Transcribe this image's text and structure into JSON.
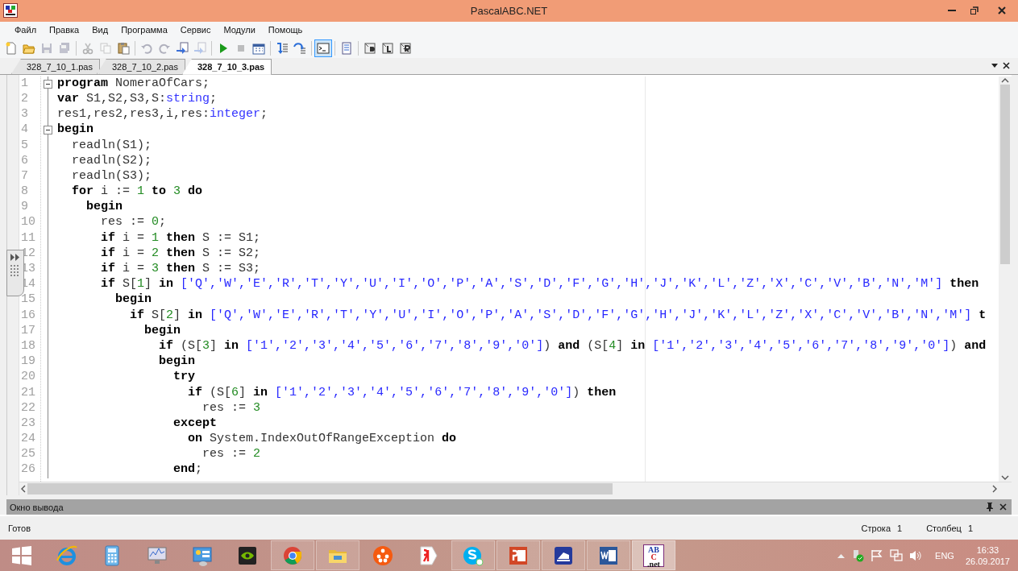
{
  "window": {
    "title": "PascalABC.NET"
  },
  "menu": [
    {
      "label": "Файл"
    },
    {
      "label": "Правка"
    },
    {
      "label": "Вид"
    },
    {
      "label": "Программа"
    },
    {
      "label": "Сервис"
    },
    {
      "label": "Модули"
    },
    {
      "label": "Помощь"
    }
  ],
  "toolbar": [
    {
      "kind": "new",
      "disabled": false,
      "pressed": false
    },
    {
      "kind": "open",
      "disabled": false,
      "pressed": false
    },
    {
      "kind": "save",
      "disabled": true,
      "pressed": false
    },
    {
      "kind": "saveall",
      "disabled": true,
      "pressed": false
    },
    {
      "kind": "separator"
    },
    {
      "kind": "cut",
      "disabled": true,
      "pressed": false
    },
    {
      "kind": "copy",
      "disabled": true,
      "pressed": false
    },
    {
      "kind": "paste",
      "disabled": false,
      "pressed": false
    },
    {
      "kind": "separator"
    },
    {
      "kind": "undo",
      "disabled": true,
      "pressed": false
    },
    {
      "kind": "redo",
      "disabled": true,
      "pressed": false
    },
    {
      "kind": "docarrow",
      "disabled": false,
      "pressed": false
    },
    {
      "kind": "docarrow",
      "disabled": true,
      "pressed": false
    },
    {
      "kind": "separator"
    },
    {
      "kind": "run",
      "disabled": false,
      "pressed": false
    },
    {
      "kind": "stop",
      "disabled": true,
      "pressed": false
    },
    {
      "kind": "calendar",
      "disabled": false,
      "pressed": false
    },
    {
      "kind": "separator"
    },
    {
      "kind": "stepinto",
      "disabled": false,
      "pressed": false
    },
    {
      "kind": "stepover",
      "disabled": false,
      "pressed": false
    },
    {
      "kind": "separator"
    },
    {
      "kind": "console",
      "disabled": false,
      "pressed": true
    },
    {
      "kind": "separator"
    },
    {
      "kind": "doc",
      "disabled": false,
      "pressed": false
    },
    {
      "kind": "separator"
    },
    {
      "kind": "tplD",
      "disabled": false,
      "pressed": false
    },
    {
      "kind": "tplL",
      "disabled": false,
      "pressed": false
    },
    {
      "kind": "tplR",
      "disabled": false,
      "pressed": false
    }
  ],
  "tabs": [
    {
      "label": "328_7_10_1.pas",
      "selected": false
    },
    {
      "label": "328_7_10_2.pas",
      "selected": false
    },
    {
      "label": "328_7_10_3.pas",
      "selected": true
    }
  ],
  "editor": {
    "lines": [
      {
        "number": "1",
        "fold": true,
        "tokens": [
          {
            "kind": "kw",
            "text": "program"
          },
          {
            "kind": "plain",
            "text": " NomeraOfCars;"
          }
        ]
      },
      {
        "number": "2",
        "fold": false,
        "tokens": [
          {
            "kind": "kw",
            "text": "var"
          },
          {
            "kind": "plain",
            "text": " S1,S2,S3,S:"
          },
          {
            "kind": "type",
            "text": "string"
          },
          {
            "kind": "plain",
            "text": ";"
          }
        ]
      },
      {
        "number": "3",
        "fold": false,
        "tokens": [
          {
            "kind": "plain",
            "text": "res1,res2,res3,i,res:"
          },
          {
            "kind": "type",
            "text": "integer"
          },
          {
            "kind": "plain",
            "text": ";"
          }
        ]
      },
      {
        "number": "4",
        "fold": true,
        "tokens": [
          {
            "kind": "kw",
            "text": "begin"
          }
        ]
      },
      {
        "number": "5",
        "fold": false,
        "tokens": [
          {
            "kind": "plain",
            "text": "  readln(S1);"
          }
        ]
      },
      {
        "number": "6",
        "fold": false,
        "tokens": [
          {
            "kind": "plain",
            "text": "  readln(S2);"
          }
        ]
      },
      {
        "number": "7",
        "fold": false,
        "tokens": [
          {
            "kind": "plain",
            "text": "  readln(S3);"
          }
        ]
      },
      {
        "number": "8",
        "fold": false,
        "tokens": [
          {
            "kind": "kw",
            "text": "  for"
          },
          {
            "kind": "plain",
            "text": " i := "
          },
          {
            "kind": "num",
            "text": "1"
          },
          {
            "kind": "kw",
            "text": " to"
          },
          {
            "kind": "num",
            "text": " 3"
          },
          {
            "kind": "kw",
            "text": " do"
          }
        ]
      },
      {
        "number": "9",
        "fold": false,
        "tokens": [
          {
            "kind": "kw",
            "text": "    begin"
          }
        ]
      },
      {
        "number": "10",
        "fold": false,
        "tokens": [
          {
            "kind": "plain",
            "text": "      res := "
          },
          {
            "kind": "num",
            "text": "0"
          },
          {
            "kind": "plain",
            "text": ";"
          }
        ]
      },
      {
        "number": "11",
        "fold": false,
        "tokens": [
          {
            "kind": "kw",
            "text": "      if"
          },
          {
            "kind": "plain",
            "text": " i = "
          },
          {
            "kind": "num",
            "text": "1"
          },
          {
            "kind": "kw",
            "text": " then"
          },
          {
            "kind": "plain",
            "text": " S := S1;"
          }
        ]
      },
      {
        "number": "12",
        "fold": false,
        "tokens": [
          {
            "kind": "kw",
            "text": "      if"
          },
          {
            "kind": "plain",
            "text": " i = "
          },
          {
            "kind": "num",
            "text": "2"
          },
          {
            "kind": "kw",
            "text": " then"
          },
          {
            "kind": "plain",
            "text": " S := S2;"
          }
        ]
      },
      {
        "number": "13",
        "fold": false,
        "tokens": [
          {
            "kind": "kw",
            "text": "      if"
          },
          {
            "kind": "plain",
            "text": " i = "
          },
          {
            "kind": "num",
            "text": "3"
          },
          {
            "kind": "kw",
            "text": " then"
          },
          {
            "kind": "plain",
            "text": " S := S3;"
          }
        ]
      },
      {
        "number": "14",
        "fold": false,
        "tokens": [
          {
            "kind": "kw",
            "text": "      if"
          },
          {
            "kind": "plain",
            "text": " S["
          },
          {
            "kind": "num",
            "text": "1"
          },
          {
            "kind": "plain",
            "text": "] "
          },
          {
            "kind": "kw",
            "text": "in"
          },
          {
            "kind": "str",
            "text": " ['Q','W','E','R','T','Y','U','I','O','P','A','S','D','F','G','H','J','K','L','Z','X','C','V','B','N','M']"
          },
          {
            "kind": "kw",
            "text": " then"
          }
        ]
      },
      {
        "number": "15",
        "fold": false,
        "tokens": [
          {
            "kind": "kw",
            "text": "        begin"
          }
        ]
      },
      {
        "number": "16",
        "fold": false,
        "tokens": [
          {
            "kind": "kw",
            "text": "          if"
          },
          {
            "kind": "plain",
            "text": " S["
          },
          {
            "kind": "num",
            "text": "2"
          },
          {
            "kind": "plain",
            "text": "] "
          },
          {
            "kind": "kw",
            "text": "in"
          },
          {
            "kind": "str",
            "text": " ['Q','W','E','R','T','Y','U','I','O','P','A','S','D','F','G','H','J','K','L','Z','X','C','V','B','N','M']"
          },
          {
            "kind": "kw",
            "text": " t"
          }
        ]
      },
      {
        "number": "17",
        "fold": false,
        "tokens": [
          {
            "kind": "kw",
            "text": "            begin"
          }
        ]
      },
      {
        "number": "18",
        "fold": false,
        "tokens": [
          {
            "kind": "kw",
            "text": "              if"
          },
          {
            "kind": "plain",
            "text": " (S["
          },
          {
            "kind": "num",
            "text": "3"
          },
          {
            "kind": "plain",
            "text": "] "
          },
          {
            "kind": "kw",
            "text": "in"
          },
          {
            "kind": "str",
            "text": " ['1','2','3','4','5','6','7','8','9','0']"
          },
          {
            "kind": "plain",
            "text": ") "
          },
          {
            "kind": "kw",
            "text": "and"
          },
          {
            "kind": "plain",
            "text": " (S["
          },
          {
            "kind": "num",
            "text": "4"
          },
          {
            "kind": "plain",
            "text": "] "
          },
          {
            "kind": "kw",
            "text": "in"
          },
          {
            "kind": "str",
            "text": " ['1','2','3','4','5','6','7','8','9','0']"
          },
          {
            "kind": "plain",
            "text": ") "
          },
          {
            "kind": "kw",
            "text": "and"
          }
        ]
      },
      {
        "number": "19",
        "fold": false,
        "tokens": [
          {
            "kind": "kw",
            "text": "              begin"
          }
        ]
      },
      {
        "number": "20",
        "fold": false,
        "tokens": [
          {
            "kind": "kw",
            "text": "                try"
          }
        ]
      },
      {
        "number": "21",
        "fold": false,
        "tokens": [
          {
            "kind": "kw",
            "text": "                  if"
          },
          {
            "kind": "plain",
            "text": " (S["
          },
          {
            "kind": "num",
            "text": "6"
          },
          {
            "kind": "plain",
            "text": "] "
          },
          {
            "kind": "kw",
            "text": "in"
          },
          {
            "kind": "str",
            "text": " ['1','2','3','4','5','6','7','8','9','0']"
          },
          {
            "kind": "plain",
            "text": ") "
          },
          {
            "kind": "kw",
            "text": "then"
          }
        ]
      },
      {
        "number": "22",
        "fold": false,
        "tokens": [
          {
            "kind": "plain",
            "text": "                    res := "
          },
          {
            "kind": "num",
            "text": "3"
          }
        ]
      },
      {
        "number": "23",
        "fold": false,
        "tokens": [
          {
            "kind": "kw",
            "text": "                except"
          }
        ]
      },
      {
        "number": "24",
        "fold": false,
        "tokens": [
          {
            "kind": "kw",
            "text": "                  on"
          },
          {
            "kind": "plain",
            "text": " System.IndexOutOfRangeException "
          },
          {
            "kind": "kw",
            "text": "do"
          }
        ]
      },
      {
        "number": "25",
        "fold": false,
        "tokens": [
          {
            "kind": "plain",
            "text": "                    res := "
          },
          {
            "kind": "num",
            "text": "2"
          }
        ]
      },
      {
        "number": "26",
        "fold": false,
        "tokens": [
          {
            "kind": "kw",
            "text": "                end"
          },
          {
            "kind": "plain",
            "text": ";"
          }
        ]
      }
    ]
  },
  "output_panel": {
    "title": "Окно вывода"
  },
  "status_bar": {
    "state": "Готов",
    "row_label": "Строка",
    "row": "1",
    "col_label": "Столбец",
    "col": "1"
  },
  "taskbar": {
    "apps": [
      {
        "kind": "ie",
        "running": false,
        "active": false
      },
      {
        "kind": "calculator",
        "running": false,
        "active": false
      },
      {
        "kind": "monitor",
        "running": false,
        "active": false
      },
      {
        "kind": "panel",
        "running": false,
        "active": false
      },
      {
        "kind": "gpu",
        "running": false,
        "active": false
      },
      {
        "kind": "chrome",
        "running": true,
        "active": false
      },
      {
        "kind": "folder",
        "running": true,
        "active": false
      },
      {
        "kind": "film",
        "running": false,
        "active": false
      },
      {
        "kind": "yandex",
        "running": false,
        "active": false
      },
      {
        "kind": "skype",
        "running": true,
        "active": false
      },
      {
        "kind": "powerpoint",
        "running": true,
        "active": false
      },
      {
        "kind": "reader",
        "running": true,
        "active": false
      },
      {
        "kind": "word",
        "running": true,
        "active": false
      },
      {
        "kind": "abc",
        "running": true,
        "active": true,
        "logo": [
          "AB",
          "C",
          ".net"
        ]
      }
    ],
    "language": "ENG",
    "time": "16:33",
    "date": "26.09.2017"
  }
}
